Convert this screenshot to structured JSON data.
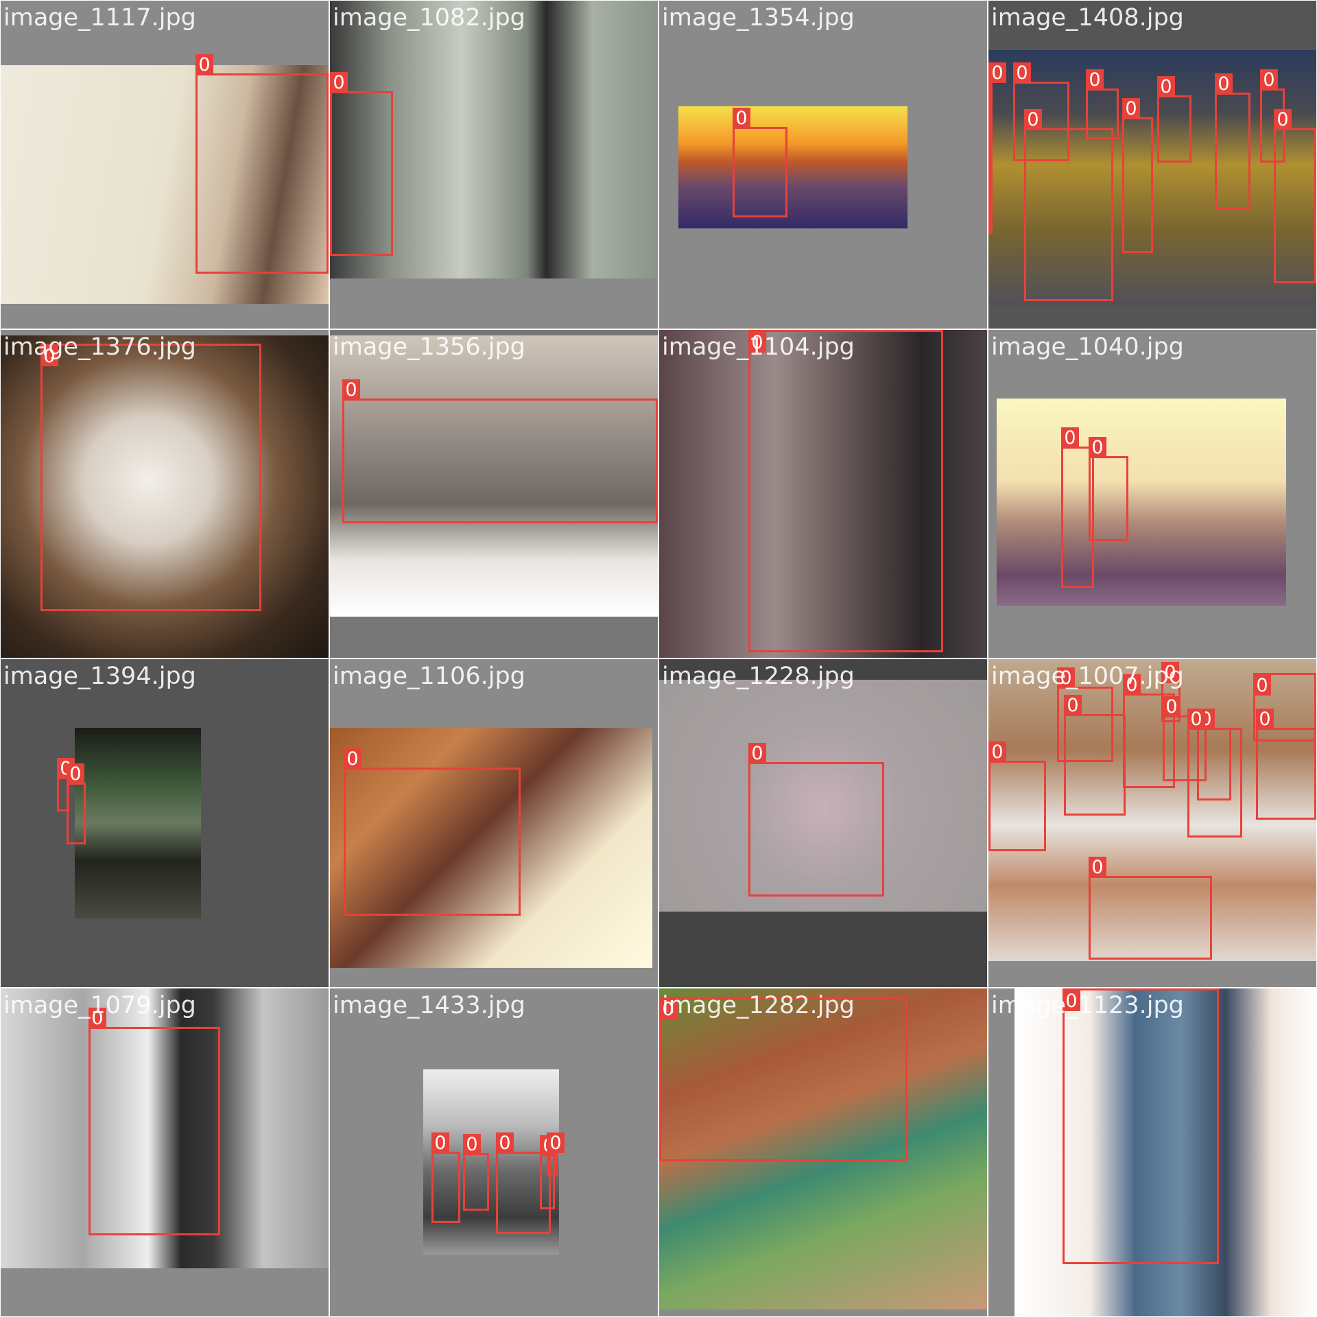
{
  "grid": {
    "background": "#ffffff",
    "box_color": "#e8413a",
    "tiles": [
      {
        "file": "image_1117.jpg",
        "pad": "#8a8a8a",
        "photo_bg": "linear-gradient(100deg,#efeadc 0%,#e8e2cf 50%,#cdb8a0 68%,#6a5040 82%,#e0c8b0 100%)",
        "labels": [
          "0"
        ]
      },
      {
        "file": "image_1082.jpg",
        "pad": "#8a8a8a",
        "photo_bg": "linear-gradient(90deg,#3a3a3a 0%,#8a9086 18%,#c6ccc2 40%,#7f877c 60%,#2a2a2a 66%,#a8b0a4 80%,#8b9488 100%)",
        "labels": [
          "0"
        ]
      },
      {
        "file": "image_1354.jpg",
        "pad": "#8a8a8a",
        "photo_bg": "linear-gradient(180deg,#f4e04a 0%,#f59a2a 30%,#c05a2a 45%,#6a4a6a 65%,#332a66 100%)",
        "labels": [
          "0"
        ]
      },
      {
        "file": "image_1408.jpg",
        "pad": "#555555",
        "photo_bg": "linear-gradient(180deg,#2c3c5c 0%,#4a4a50 25%,#b09030 45%,#7a6630 70%,#505058 100%)",
        "labels": [
          "0",
          "0",
          "0",
          "0",
          "0",
          "0",
          "0",
          "0",
          "0",
          "0"
        ]
      },
      {
        "file": "image_1376.jpg",
        "pad": "#8a8a8a",
        "photo_bg": "radial-gradient(ellipse at 45% 45%,#f2eee8 0%,#d8cfc4 25%,#7a5a40 50%,#3a2a1e 75%,#1e1812 100%)",
        "labels": [
          "0"
        ]
      },
      {
        "file": "image_1356.jpg",
        "pad": "#777777",
        "photo_bg": "linear-gradient(180deg,#cfc6bb 0%,#8f8680 40%,#6f6862 60%,#e9e6e2 80%,#ffffff 100%)",
        "labels": [
          "0"
        ]
      },
      {
        "file": "image_1104.jpg",
        "pad": "#444444",
        "photo_bg": "linear-gradient(90deg,#5a4448 0%,#9a8a8a 35%,#6a5a5a 55%,#2a2628 80%,#4a4246 100%)",
        "labels": [
          "0"
        ]
      },
      {
        "file": "image_1040.jpg",
        "pad": "#8a8a8a",
        "photo_bg": "linear-gradient(180deg,#fcf7c0 0%,#f3dfb0 40%,#b08a78 60%,#6a4a66 85%,#8a6a86 100%)",
        "labels": [
          "0",
          "0"
        ]
      },
      {
        "file": "image_1394.jpg",
        "pad": "#555555",
        "photo_bg": "linear-gradient(180deg,#1a1c18 0%,#3e5a3a 30%,#6a7a60 50%,#22241e 70%,#4a4a40 100%)",
        "labels": [
          "0",
          "0"
        ]
      },
      {
        "file": "image_1106.jpg",
        "pad": "#8a8a8a",
        "photo_bg": "linear-gradient(135deg,#a05a2a 0%,#c8804a 25%,#6a3a2a 45%,#f1e6c8 70%,#fffbe0 100%)",
        "labels": [
          "0"
        ]
      },
      {
        "file": "image_1228.jpg",
        "pad": "#444444",
        "photo_bg": "radial-gradient(circle at 50% 55%,#c8b0b8 0%,#a9a1a3 40%,#9f9a9a 100%)",
        "labels": [
          "0"
        ]
      },
      {
        "file": "image_1007.jpg",
        "pad": "#8a8a8a",
        "photo_bg": "linear-gradient(180deg,#c0aa90 0%,#a87a58 30%,#e8e4e0 55%,#c08a68 75%,#e2d8d0 100%)",
        "labels": [
          "0",
          "0",
          "0",
          "0",
          "0",
          "0",
          "0",
          "0",
          "0",
          "0",
          "0",
          "0"
        ]
      },
      {
        "file": "image_1079.jpg",
        "pad": "#8a8a8a",
        "photo_bg": "linear-gradient(90deg,#d8d8d8 0%,#a8a8a8 25%,#eeeeee 45%,#2a2a2a 55%,#3a3a3a 65%,#c4c4c4 80%,#9a9a9a 100%)",
        "labels": [
          "0"
        ]
      },
      {
        "file": "image_1433.jpg",
        "pad": "#8a8a8a",
        "photo_bg": "linear-gradient(180deg,#eeeeee 0%,#bcbcbc 30%,#6a6a6a 55%,#3c3c3c 80%,#9a9a9a 100%)",
        "labels": [
          "0",
          "0",
          "0",
          "0",
          "0"
        ]
      },
      {
        "file": "image_1282.jpg",
        "pad": "#8a8a8a",
        "photo_bg": "linear-gradient(160deg,#6a8a3a 0%,#a85a3a 25%,#b8704a 40%,#3e8a70 55%,#7aa860 70%,#c89878 100%)",
        "labels": [
          "0"
        ]
      },
      {
        "file": "image_1123.jpg",
        "pad": "#8a8a8a",
        "photo_bg": "linear-gradient(90deg,#ffffff 0%,#f4ece6 25%,#4a6a8a 40%,#6a8aa4 55%,#3a4a62 70%,#f2e4dc 85%,#ffffff 100%)",
        "labels": [
          "0"
        ]
      }
    ]
  }
}
